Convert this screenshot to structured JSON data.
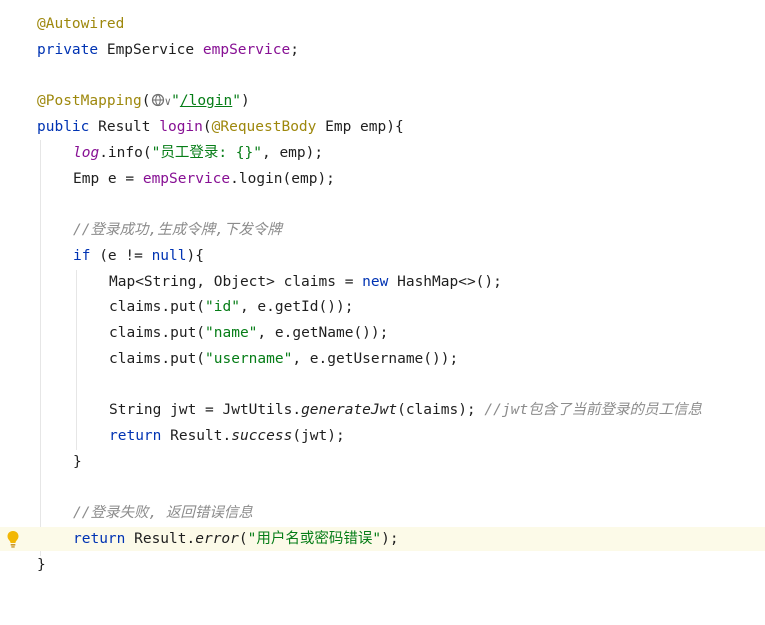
{
  "code": {
    "l01": [
      "@Autowired"
    ],
    "l02": [
      "private",
      " EmpService ",
      "empService",
      ";"
    ],
    "l04": [
      "@PostMapping",
      "(",
      "∨",
      "\"",
      "/login",
      "\"",
      ")"
    ],
    "l05": [
      "public",
      " Result ",
      "login",
      "(",
      "@RequestBody",
      " Emp emp){"
    ],
    "l06": [
      "log",
      ".info(",
      "\"员工登录: {}\"",
      ", emp);"
    ],
    "l07": [
      "Emp e = ",
      "empService",
      ".login(emp);"
    ],
    "l09": [
      "//登录成功,生成令牌,下发令牌"
    ],
    "l10": [
      "if",
      " (e != ",
      "null",
      "){"
    ],
    "l11": [
      "Map<String, Object> claims = ",
      "new",
      " HashMap<>();"
    ],
    "l12": [
      "claims.put(",
      "\"id\"",
      ", e.getId());"
    ],
    "l13": [
      "claims.put(",
      "\"name\"",
      ", e.getName());"
    ],
    "l14": [
      "claims.put(",
      "\"username\"",
      ", e.getUsername());"
    ],
    "l16": [
      "String jwt = JwtUtils.",
      "generateJwt",
      "(claims); ",
      "//jwt包含了当前登录的员工信息"
    ],
    "l17": [
      "return",
      " Result.",
      "success",
      "(jwt);"
    ],
    "l18": [
      "}"
    ],
    "l20": [
      "//登录失败, 返回错误信息"
    ],
    "l21": [
      "return",
      " Result.",
      "error",
      "(",
      "\"用户名或密码错误\"",
      ");"
    ],
    "l22": [
      "}"
    ]
  },
  "icons": {
    "gutter": "lightbulb-icon",
    "inline": "web-endpoint-globe-icon"
  },
  "colors": {
    "annotation": "#9e880d",
    "keyword": "#0033b3",
    "field": "#871094",
    "string": "#067d17",
    "comment": "#8c8c8c",
    "current_line": "#fcfae8",
    "bulb": "#f2b705"
  }
}
